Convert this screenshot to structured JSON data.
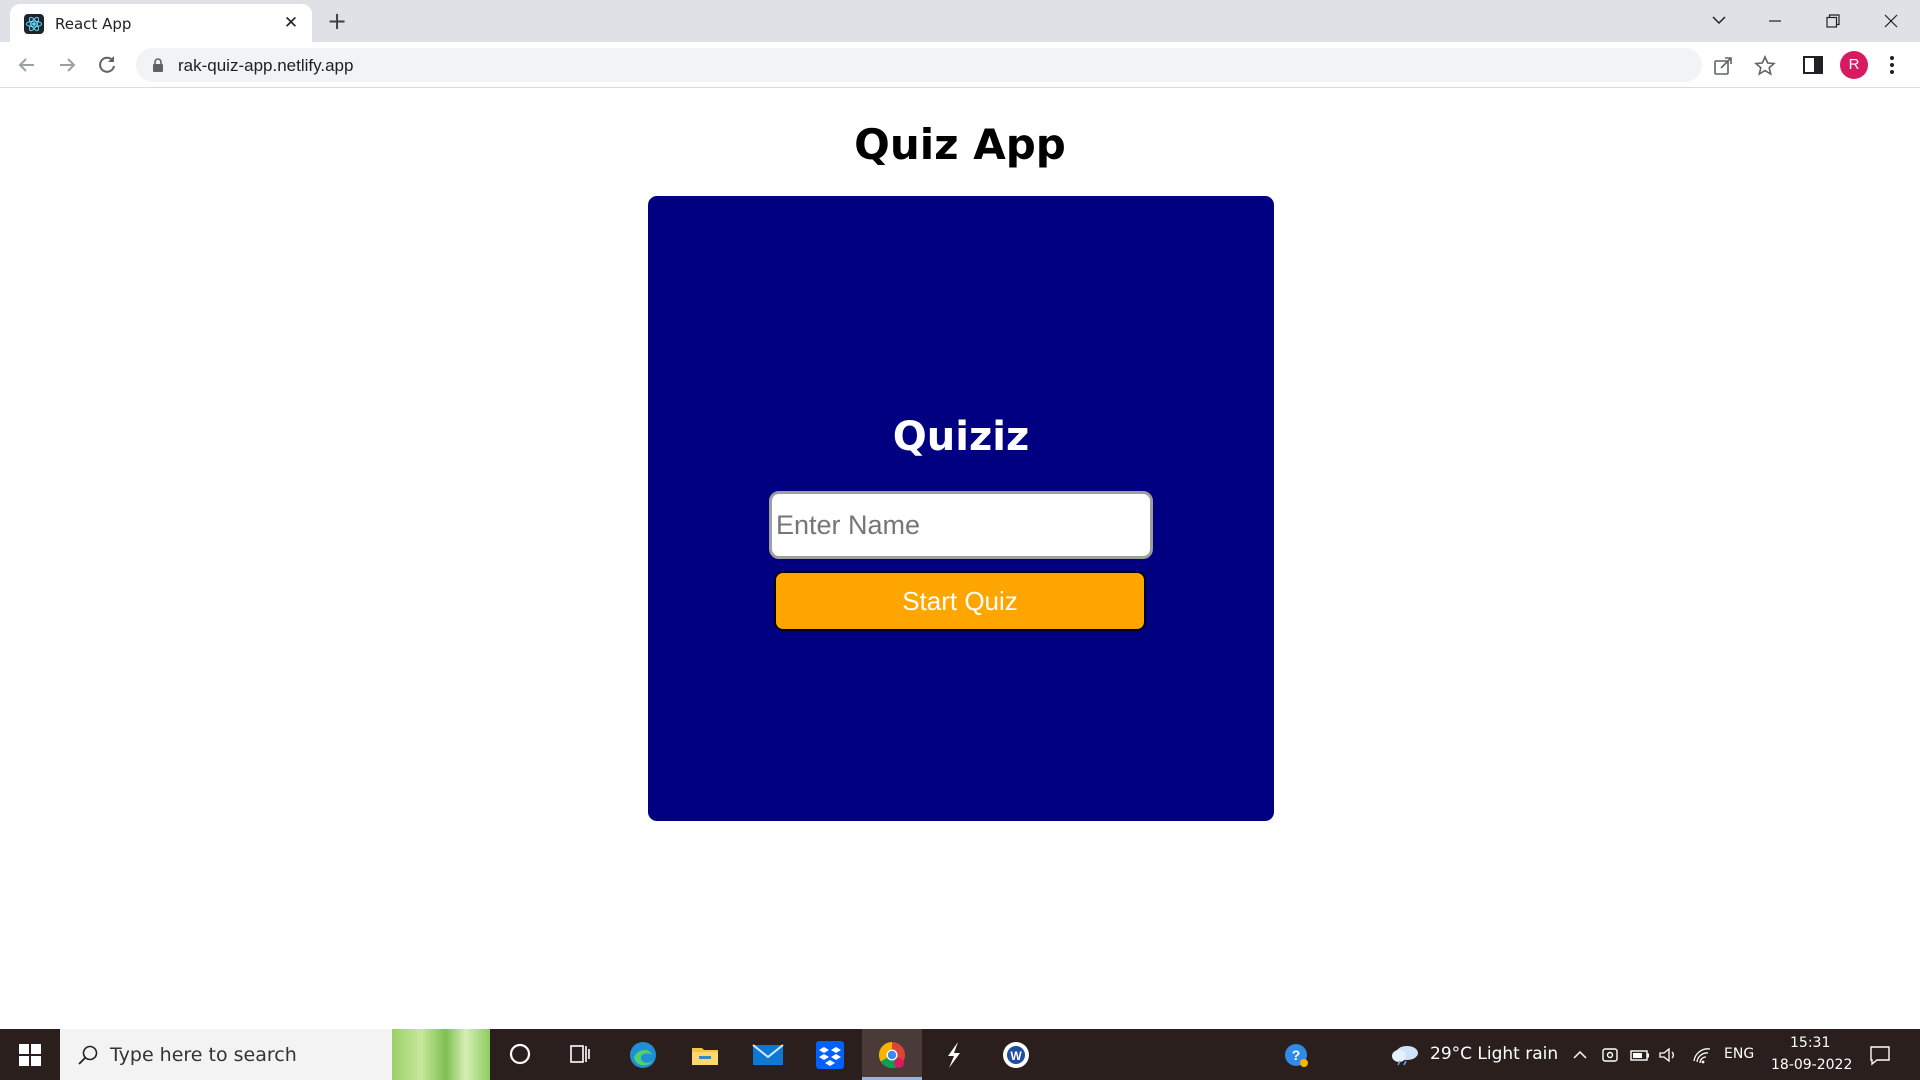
{
  "browser": {
    "tab_title": "React App",
    "tab_close": "✕",
    "new_tab": "+",
    "url": "rak-quiz-app.netlify.app",
    "profile_initial": "R"
  },
  "page": {
    "title": "Quiz App",
    "card": {
      "heading": "Quiziz",
      "name_input_placeholder": "Enter Name",
      "name_input_value": "",
      "start_button_label": "Start Quiz"
    },
    "colors": {
      "card_background": "#000080",
      "button_background": "#ffa500"
    }
  },
  "taskbar": {
    "search_placeholder": "Type here to search",
    "weather": "29°C  Light rain",
    "language": "ENG",
    "time": "15:31",
    "date": "18-09-2022",
    "apps": [
      "task-view-icon",
      "edge-icon",
      "file-explorer-icon",
      "mail-icon",
      "dropbox-icon",
      "chrome-icon",
      "app-s-icon",
      "word-icon"
    ]
  }
}
